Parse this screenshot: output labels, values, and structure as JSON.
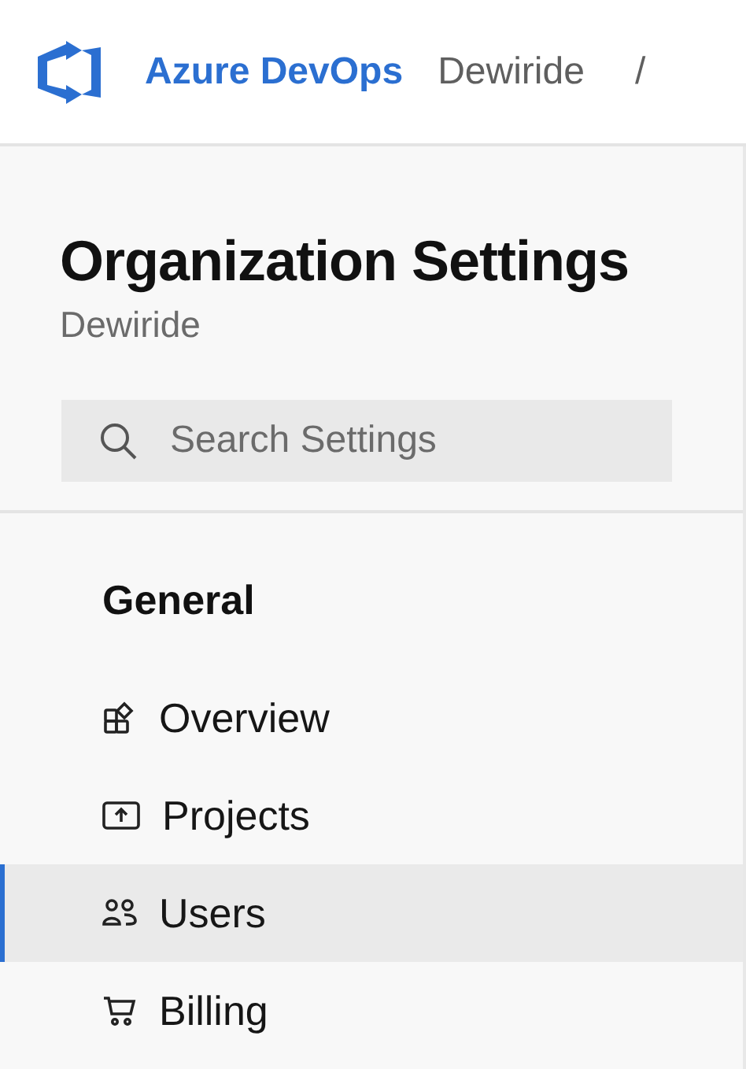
{
  "header": {
    "product": "Azure DevOps",
    "organization": "Dewiride",
    "separator": "/"
  },
  "sidebar": {
    "title": "Organization Settings",
    "subtitle": "Dewiride",
    "search": {
      "placeholder": "Search Settings"
    },
    "section": "General",
    "items": [
      {
        "label": "Overview",
        "selected": false
      },
      {
        "label": "Projects",
        "selected": false
      },
      {
        "label": "Users",
        "selected": true
      },
      {
        "label": "Billing",
        "selected": false
      }
    ]
  }
}
